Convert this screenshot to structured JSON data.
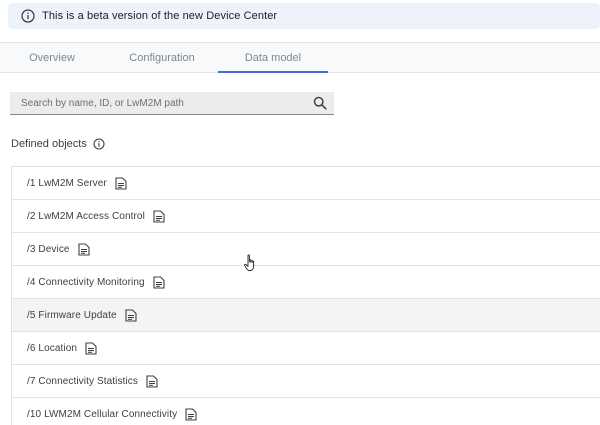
{
  "banner": {
    "icon": "info-icon",
    "text": "This is a beta version of the new Device Center"
  },
  "tabs": [
    {
      "label": "Overview",
      "active": false
    },
    {
      "label": "Configuration",
      "active": false
    },
    {
      "label": "Data model",
      "active": true
    }
  ],
  "search": {
    "placeholder": "Search by name, ID, or LwM2M path",
    "value": "",
    "icon": "search-icon"
  },
  "defined_objects": {
    "title": "Defined objects",
    "icon": "info-icon",
    "items": [
      {
        "label": "/1 LwM2M Server",
        "icon": "document-icon"
      },
      {
        "label": "/2 LwM2M Access Control",
        "icon": "document-icon"
      },
      {
        "label": "/3 Device",
        "icon": "document-icon"
      },
      {
        "label": "/4 Connectivity Monitoring",
        "icon": "document-icon"
      },
      {
        "label": "/5 Firmware Update",
        "icon": "document-icon"
      },
      {
        "label": "/6 Location",
        "icon": "document-icon"
      },
      {
        "label": "/7 Connectivity Statistics",
        "icon": "document-icon"
      },
      {
        "label": "/10 LWM2M Cellular Connectivity",
        "icon": "document-icon"
      }
    ]
  },
  "colors": {
    "banner_background": "#eef2fb",
    "active_tab_indicator": "#4a6ad8",
    "tab_text": "#80868b",
    "row_border": "#e2e2e2",
    "hovered_row": "#f4f4f4"
  }
}
